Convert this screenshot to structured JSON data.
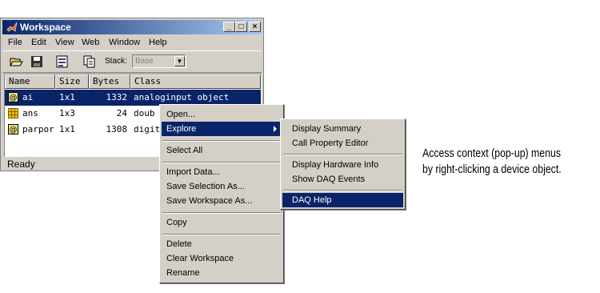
{
  "window": {
    "title": "Workspace",
    "controls": [
      "_",
      "□",
      "×"
    ]
  },
  "menubar": [
    "File",
    "Edit",
    "View",
    "Web",
    "Window",
    "Help"
  ],
  "toolbar": {
    "stack_label": "Stack:",
    "stack_value": "Base",
    "icons": [
      "open-folder-icon",
      "save-icon",
      "import-data-icon",
      "new-variable-icon"
    ]
  },
  "table": {
    "headers": [
      "Name",
      "Size",
      "Bytes",
      "Class"
    ],
    "rows": [
      {
        "icon": "object-icon",
        "name": "ai",
        "size": "1x1",
        "bytes": "1332",
        "class": "analoginput object",
        "selected": true
      },
      {
        "icon": "array-icon",
        "name": "ans",
        "size": "1x3",
        "bytes": "24",
        "class": "doub",
        "selected": false
      },
      {
        "icon": "object-icon",
        "name": "parpor",
        "size": "1x1",
        "bytes": "1308",
        "class": "digit",
        "selected": false
      }
    ]
  },
  "status": "Ready",
  "context_menu": {
    "items": [
      "Open...",
      "Explore",
      "Select All",
      "Import Data...",
      "Save Selection As...",
      "Save Workspace As...",
      "Copy",
      "Delete",
      "Clear Workspace",
      "Rename"
    ],
    "highlighted": "Explore"
  },
  "submenu": {
    "items": [
      "Display Summary",
      "Call Property Editor",
      "Display Hardware Info",
      "Show DAQ Events",
      "DAQ Help"
    ],
    "highlighted": "DAQ Help"
  },
  "caption": {
    "line1": "Access context (pop-up) menus",
    "line2": "by right-clicking a device object."
  },
  "colors": {
    "selection": "#0a246a",
    "face": "#d4d0c8"
  }
}
